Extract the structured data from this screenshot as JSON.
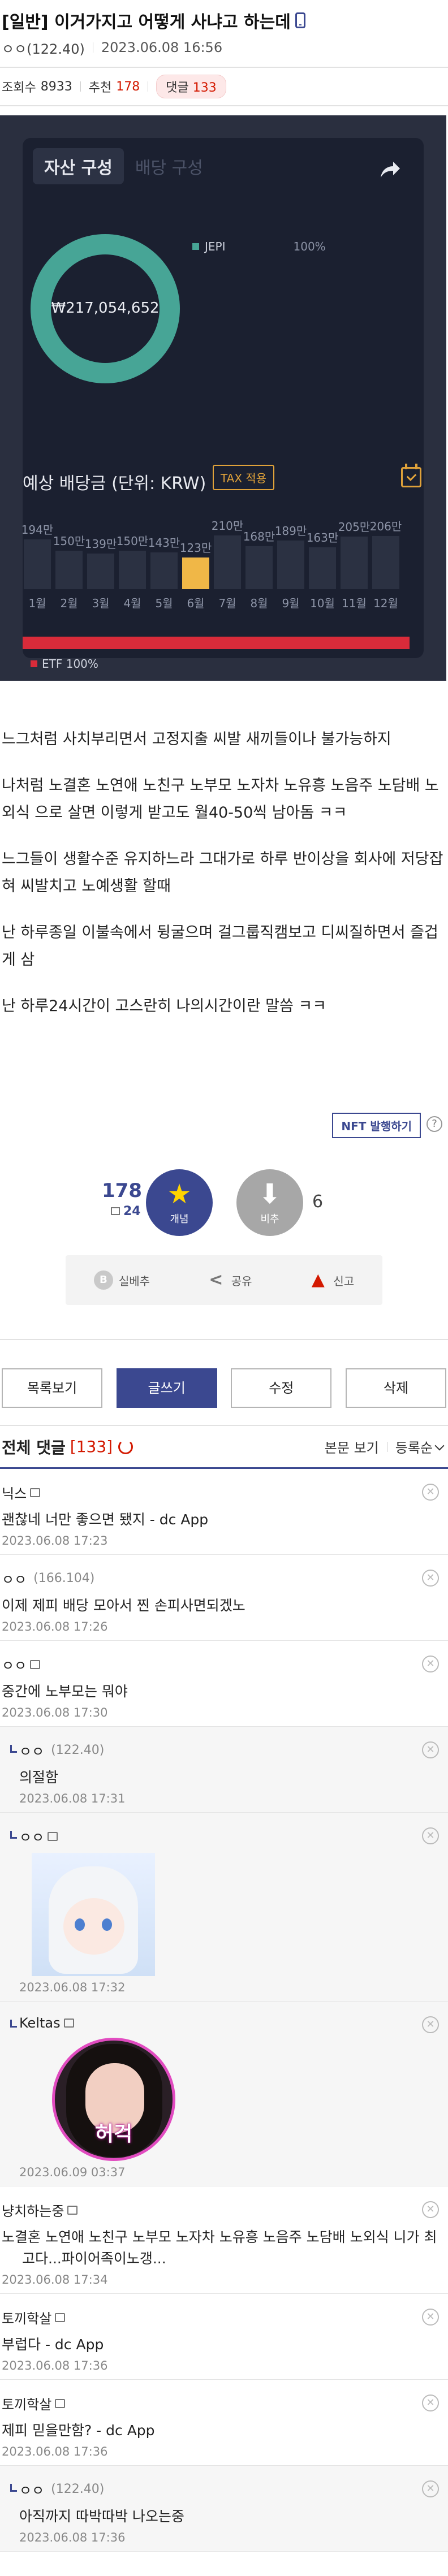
{
  "post": {
    "title": "[일반] 이거가지고 어떻게 사냐고 하는데",
    "author": "ㅇㅇ(122.40)",
    "date": "2023.06.08 16:56",
    "views_label": "조회수",
    "views": "8933",
    "recommend_label": "추천",
    "recommend": "178",
    "comments_label": "댓글",
    "comments": "133"
  },
  "app": {
    "tab_active": "자산 구성",
    "tab_inactive": "배당 구성",
    "total": "₩217,054,652",
    "legend_name": "JEPI",
    "legend_pct": "100%",
    "dividend_title": "예상 배당금 (단위: KRW)",
    "tax_label": "TAX 적용",
    "etf_label": "ETF 100%"
  },
  "chart_data": {
    "type": "bar",
    "title": "예상 배당금 (단위: KRW)",
    "categories": [
      "1월",
      "2월",
      "3월",
      "4월",
      "5월",
      "6월",
      "7월",
      "8월",
      "9월",
      "10월",
      "11월",
      "12월"
    ],
    "values": [
      194,
      150,
      139,
      150,
      143,
      123,
      210,
      168,
      189,
      163,
      205,
      206
    ],
    "value_labels": [
      "194만",
      "150만",
      "139만",
      "150만",
      "143만",
      "123만",
      "210만",
      "168만",
      "189만",
      "163만",
      "205만",
      "206만"
    ],
    "highlight_index": 5,
    "ylim": [
      0,
      220
    ]
  },
  "body": [
    "느그처럼 사치부리면서 고정지출 씨발 새끼들이나 불가능하지",
    "나처럼 노결혼 노연애 노친구 노부모 노자차 노유흥 노음주 노담배 노외식 으로 살면 이렇게 받고도 월40-50씩 남아돔 ㅋㅋ",
    "느그들이 생활수준 유지하느라 그대가로 하루 반이상을 회사에 저당잡혀 씨발치고 노예생활 할때",
    "난 하루종일 이불속에서 뒹굴으며 걸그룹직캠보고 디씨질하면서 즐겁게 삼",
    "난 하루24시간이 고스란히 나의시간이란 말씀 ㅋㅋ"
  ],
  "nft_button": "NFT 발행하기",
  "help_glyph": "?",
  "recommend_box": {
    "up_count": "178",
    "fixed_count": "24",
    "up_label": "개념",
    "down_label": "비추",
    "down_count": "6",
    "up_glyph": "★",
    "down_glyph": "⬇"
  },
  "actions": [
    {
      "icon": "B",
      "label": "실베추"
    },
    {
      "icon": "<",
      "label": "공유"
    },
    {
      "icon": "▲",
      "label": "신고"
    }
  ],
  "buttons": {
    "list": "목록보기",
    "write": "글쓰기",
    "edit": "수정",
    "delete": "삭제"
  },
  "comment_header": {
    "title": "전체 댓글",
    "count": "[133]",
    "view_body": "본문 보기",
    "sort": "등록순"
  },
  "comments": [
    {
      "nick": "닉스",
      "ip": "",
      "text": "괜찮네 너만 좋으면 됐지 - dc App",
      "date": "2023.06.08 17:23",
      "reply": false
    },
    {
      "nick": "ㅇㅇ",
      "ip": "(166.104)",
      "text": "이제 제피 배당 모아서 찐 손피사면되겠노",
      "date": "2023.06.08 17:26",
      "reply": false
    },
    {
      "nick": "ㅇㅇ",
      "ip": "",
      "text": "중간에 노부모는 뭐야",
      "date": "2023.06.08 17:30",
      "reply": false
    },
    {
      "nick": "ㅇㅇ",
      "ip": "(122.40)",
      "text": "의절함",
      "date": "2023.06.08 17:31",
      "reply": true
    },
    {
      "nick": "ㅇㅇ",
      "ip": "",
      "text": "",
      "date": "2023.06.08 17:32",
      "reply": true,
      "image": "shark"
    },
    {
      "nick": "Keltas",
      "ip": "",
      "text": "",
      "date": "2023.06.09 03:37",
      "reply": true,
      "image": "face",
      "caption": "허걱"
    },
    {
      "nick": "냥치하는중",
      "ip": "",
      "text": "노결혼 노연애 노친구 노부모 노자차 노유흥 노음주 노담배 노외식 니가 최고다...파이어족이노갱...",
      "date": "2023.06.08 17:34",
      "reply": false
    },
    {
      "nick": "토끼학살",
      "ip": "",
      "text": "부럽다 - dc App",
      "date": "2023.06.08 17:36",
      "reply": false
    },
    {
      "nick": "토끼학살",
      "ip": "",
      "text": "제피 믿을만함? - dc App",
      "date": "2023.06.08 17:36",
      "reply": false
    },
    {
      "nick": "ㅇㅇ",
      "ip": "(122.40)",
      "text": "아직까지 따박따박 나오는중",
      "date": "2023.06.08 17:36",
      "reply": true
    }
  ],
  "colors": {
    "accent": "#3b4890",
    "red": "#d31900",
    "teal": "#47a596",
    "gold": "#f0b747"
  }
}
